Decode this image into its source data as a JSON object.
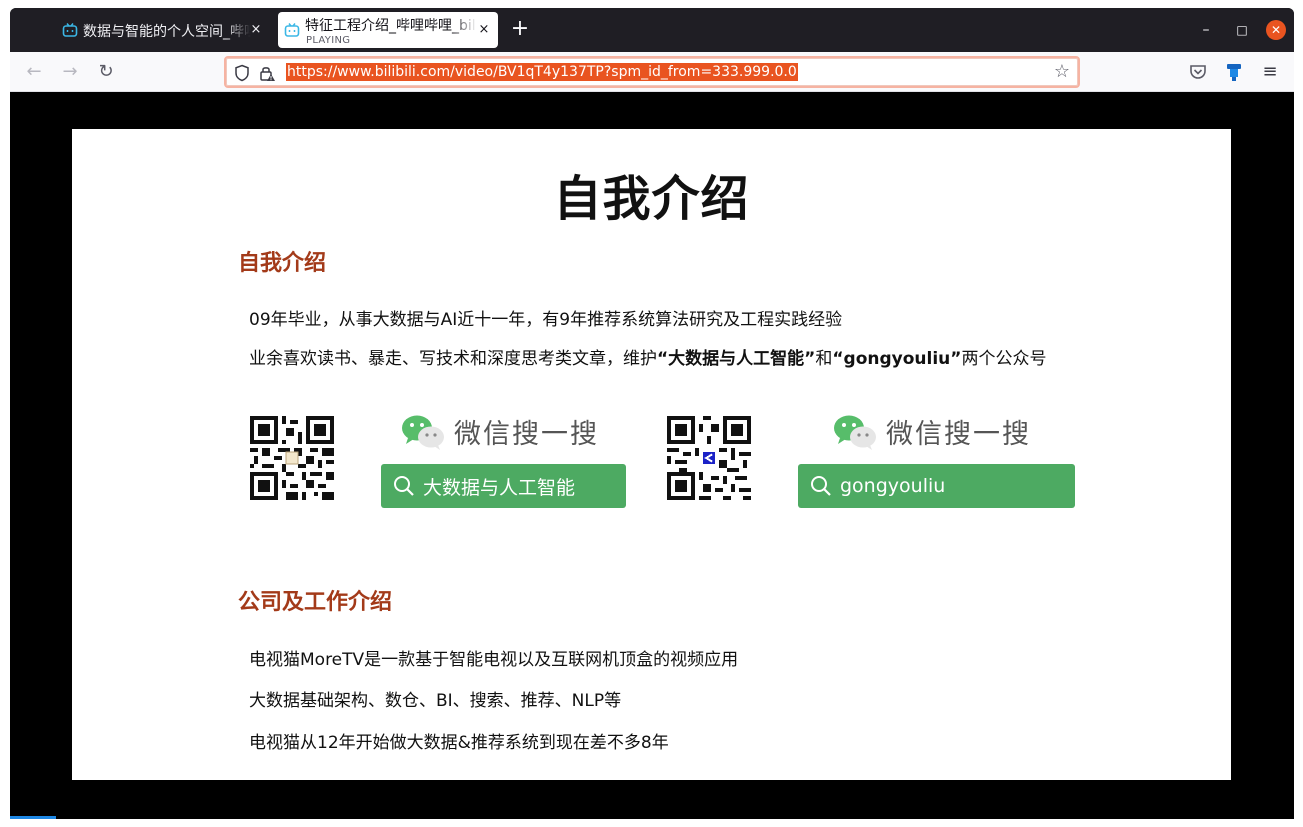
{
  "browser": {
    "tabs": [
      {
        "title": "数据与智能的个人空间_哔哩哔哩_bilibili",
        "close": "×",
        "active": false
      },
      {
        "title": "特征工程介绍_哔哩哔哩_bilibili",
        "subtitle": "PLAYING",
        "close": "×",
        "active": true
      }
    ],
    "new_tab": "+",
    "window_controls": {
      "minimize": "–",
      "maximize": "□",
      "close": "✕"
    },
    "nav": {
      "back": "←",
      "forward": "→",
      "reload": "↻"
    },
    "url": "https://www.bilibili.com/video/BV1qT4y137TP?spm_id_from=333.999.0.0",
    "bookmark_star": "☆",
    "menu": "≡",
    "icons": [
      "bilibili-tv-icon",
      "shield-icon",
      "lock-icon",
      "star-icon",
      "pocket-icon",
      "extension-icon",
      "hamburger-menu-icon"
    ],
    "accent_color": "#e95420"
  },
  "slide": {
    "title": "自我介绍",
    "section1": {
      "heading": "自我介绍",
      "line1": "09年毕业，从事大数据与AI近十一年，有9年推荐系统算法研究及工程实践经验",
      "line2_pre": "业余喜欢读书、暴走、写技术和深度思考类文章，维护",
      "line2_bold1": "“大数据与人工智能”",
      "line2_mid": "和",
      "line2_bold2": "“gongyouliu”",
      "line2_post": "两个公众号"
    },
    "wechat": [
      {
        "label": "微信搜一搜",
        "search": "大数据与人工智能"
      },
      {
        "label": "微信搜一搜",
        "search": "gongyouliu"
      }
    ],
    "section2": {
      "heading": "公司及工作介绍",
      "lines": [
        "电视猫MoreTV是一款基于智能电视以及互联网机顶盒的视频应用",
        "大数据基础架构、数仓、BI、搜索、推荐、NLP等",
        "电视猫从12年开始做大数据&推荐系统到现在差不多8年"
      ]
    },
    "colors": {
      "heading": "#a33a19",
      "search_green": "#4daa62"
    }
  }
}
